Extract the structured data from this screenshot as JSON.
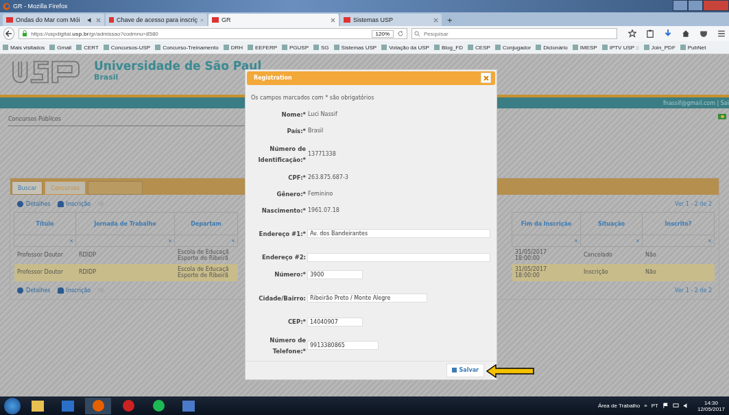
{
  "window": {
    "title": "GR - Mozilla Firefox"
  },
  "browser_tabs": [
    {
      "label": "Ondas do Mar com Mói",
      "selected": false,
      "audio": true
    },
    {
      "label": "Chave de acesso para inscriç",
      "selected": false,
      "audio": false
    },
    {
      "label": "GR",
      "selected": true,
      "audio": false
    },
    {
      "label": "Sistemas USP",
      "selected": false,
      "audio": false
    }
  ],
  "new_tab": "+",
  "address_bar": {
    "url": "https://uspdigital.**usp.br**/gr/admissao?codmnu=8580",
    "zoom": "120%"
  },
  "search": {
    "placeholder": "Pesquisar"
  },
  "bookmarks": [
    "Mais visitados",
    "Gmail",
    "CERT",
    "Concursos-USP",
    "Concurso-Treinamento",
    "DRH",
    "EEFERP",
    "PGUSP",
    "SG",
    "Sistemas USP",
    "Votação da USP",
    "Blog_FD",
    "CESP",
    "Conjugador",
    "Dicionário",
    "IMESP",
    "IPTV USP ::",
    "Join_PDF",
    "PubNet"
  ],
  "site": {
    "title": "Universidade de São Paul",
    "subtitle": "Brasil",
    "user": "fnassif@gmail.com | Sai",
    "breadcrumb": "Concursos Públicos"
  },
  "page_tabs": [
    {
      "label": "Buscar",
      "selected": false
    },
    {
      "label": "Concursos",
      "selected": true
    }
  ],
  "toolbar": [
    {
      "label": "Detalhes",
      "kind": "info"
    },
    {
      "label": "Inscrição",
      "kind": "user"
    }
  ],
  "pager": "Ver 1 - 2 de 2",
  "table": {
    "columns_left": [
      "Título",
      "Jornada de Trabalho",
      "Departam"
    ],
    "columns_right": [
      "Fim da Inscrição",
      "Situação",
      "Inscrito?"
    ],
    "rows": [
      {
        "selected": false,
        "cells_left": [
          "Professor Doutor",
          "RDIDP",
          "Escola de Educaçã\nEsporte de Ribeirã"
        ],
        "cells_right": [
          "31/05/2017\n18:00:00",
          "Cancelado",
          "Não"
        ]
      },
      {
        "selected": true,
        "cells_left": [
          "Professor Doutor",
          "RDIDP",
          "Escola de Educaçã\nEsporte de Ribeirã"
        ],
        "cells_right": [
          "31/05/2017\n18:00:00",
          "Inscrição",
          "Não"
        ]
      }
    ]
  },
  "bottom_toolbar": [
    {
      "label": "Detalhes",
      "kind": "info"
    },
    {
      "label": "Inscrição",
      "kind": "user"
    }
  ],
  "bottom_pager": "Ver 1 - 2 de 2",
  "dialog": {
    "title": "Registration",
    "note": "Os campos marcados com * são obrigatórios",
    "fields": [
      {
        "label": "Nome:*",
        "value": "Luci Nassif",
        "kind": "text"
      },
      {
        "label": "País:*",
        "value": "Brasil",
        "kind": "text"
      },
      {
        "label": "Número de Identificação:*",
        "value": "13771338",
        "kind": "text"
      },
      {
        "label": "CPF:*",
        "value": "263.875.687-3",
        "kind": "text"
      },
      {
        "label": "Gênero:*",
        "value": "Feminino",
        "kind": "text"
      },
      {
        "label": "Nascimento:*",
        "value": "1961.07.18",
        "kind": "text"
      },
      {
        "label": "Endereço #1:*",
        "value": "Av. dos Bandeirantes",
        "kind": "wide"
      },
      {
        "label": "Endereço #2:",
        "kind": "wide"
      },
      {
        "label": "Número:*",
        "value": "3900",
        "kind": "short"
      },
      {
        "label": "Cidade/Bairro:",
        "value": "Ribeirão Preto / Monte Alegre",
        "kind": "medium"
      },
      {
        "label": "CEP:*",
        "value": "14040907",
        "kind": "short"
      },
      {
        "label": "Número de Telefone:*",
        "value": "9913380865",
        "kind": "phone"
      }
    ],
    "save": "Salvar"
  },
  "taskbar": {
    "desktop": "Área de Trabalho",
    "chevron": "»",
    "language": "PT",
    "time": "14:30",
    "date": "12/05/2017"
  }
}
